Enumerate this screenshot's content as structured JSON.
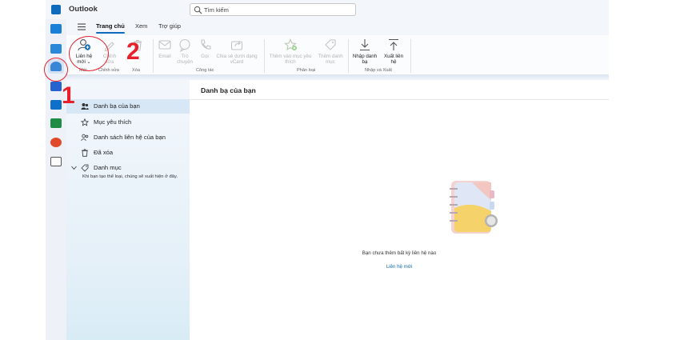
{
  "app": {
    "title": "Outlook"
  },
  "search": {
    "placeholder": "Tìm kiếm"
  },
  "tabs": [
    "Trang chủ",
    "Xem",
    "Trợ giúp"
  ],
  "ribbon": {
    "new_contact": {
      "line1": "Liên hệ",
      "line2": "mới ⌄"
    },
    "edit": {
      "line1": "Chỉnh",
      "line2": "sửa"
    },
    "email": "Email",
    "chat": {
      "line1": "Trò",
      "line2": "chuyện"
    },
    "call": "Gọi",
    "share_vcard": {
      "line1": "Chia sẻ dưới dạng",
      "line2": "vCard"
    },
    "add_favorite": {
      "line1": "Thêm vào mục yêu",
      "line2": "thích"
    },
    "categorize": {
      "line1": "Thêm danh",
      "line2": "mục"
    },
    "import": {
      "line1": "Nhập danh",
      "line2": "bạ"
    },
    "export": {
      "line1": "Xuất liên",
      "line2": "hệ"
    },
    "groups": {
      "new": "Mới",
      "edit": "Chỉnh sửa",
      "delete": "Xóa",
      "communicate": "Công tác",
      "classify": "Phân loại",
      "import_export": "Nhập và Xuất"
    }
  },
  "folders": [
    {
      "label": "Danh bạ của bạn",
      "icon": "contacts-icon"
    },
    {
      "label": "Mục yêu thích",
      "icon": "star-icon"
    },
    {
      "label": "Danh sách liên hệ của bạn",
      "icon": "contact-list-icon"
    },
    {
      "label": "Đã xóa",
      "icon": "trash-icon"
    },
    {
      "label": "Danh mục",
      "icon": "tag-icon"
    }
  ],
  "folder_note": "Khi bạn tạo thể loại, chúng sẽ xuất hiện ở đây.",
  "main": {
    "title": "Danh bạ của bạn",
    "empty_text": "Bạn chưa thêm bất kỳ liên hệ nào",
    "new_contact_link": "Liên hệ mới"
  },
  "annotations": {
    "step1": "1",
    "step2": "2"
  },
  "colors": {
    "accent": "#0f6cbd",
    "annotation": "#e8202a"
  }
}
